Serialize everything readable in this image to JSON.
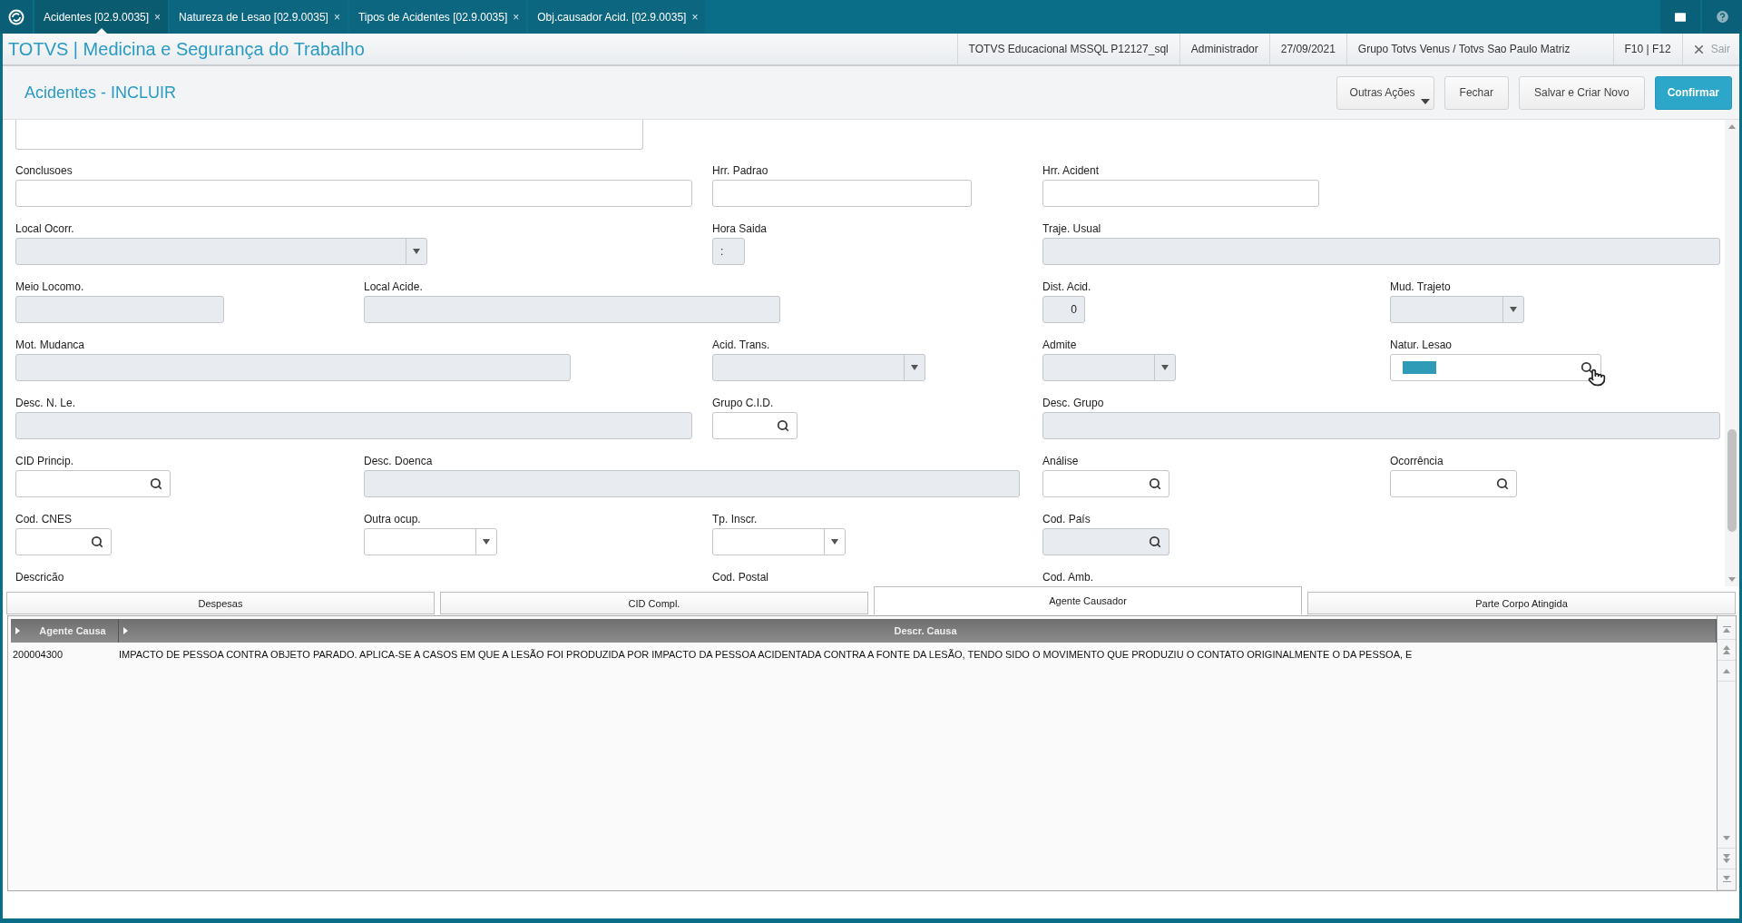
{
  "top_tabs": [
    {
      "label": "Acidentes [02.9.0035]",
      "close": "×",
      "selected": true
    },
    {
      "label": "Natureza de Lesao [02.9.0035]",
      "close": "×",
      "selected": false
    },
    {
      "label": "Tipos de Acidentes [02.9.0035]",
      "close": "×",
      "selected": false
    },
    {
      "label": "Obj.causador Acid. [02.9.0035]",
      "close": "×",
      "selected": false
    }
  ],
  "app_title": "TOTVS | Medicina e Segurança do Trabalho",
  "session_info": [
    "TOTVS Educacional MSSQL P12127_sql",
    "Administrador",
    "27/09/2021",
    "Grupo Totvs Venus / Totvs Sao Paulo Matriz"
  ],
  "hotkeys": "F10 | F12",
  "exit_label": "Sair",
  "page_title": "Acidentes - INCLUIR",
  "actions": [
    {
      "label": "Outras Ações",
      "kind": "menu"
    },
    {
      "label": "Fechar",
      "kind": "default"
    },
    {
      "label": "Salvar e Criar Novo",
      "kind": "default"
    },
    {
      "label": "Confirmar",
      "kind": "primary"
    }
  ],
  "form_rows": [
    {
      "fields": [
        {
          "label": "Conclusoes",
          "kind": "text",
          "disabled": false,
          "highlighted": false
        },
        {
          "label": "Hrr. Padrao",
          "kind": "text",
          "disabled": false,
          "highlighted": false
        },
        {
          "label": "Hrr. Acident",
          "kind": "text",
          "disabled": false,
          "highlighted": false
        }
      ]
    },
    {
      "fields": [
        {
          "label": "Local Ocorr.",
          "kind": "select",
          "disabled": true,
          "highlighted": false
        },
        {
          "label": "Hora Saida",
          "kind": "text",
          "disabled": true,
          "highlighted": false,
          "value": ":"
        },
        {
          "label": "Traje. Usual",
          "kind": "text",
          "disabled": true,
          "highlighted": false
        }
      ]
    },
    {
      "fields": [
        {
          "label": "Meio Locomo.",
          "kind": "text",
          "disabled": true,
          "highlighted": false
        },
        {
          "label": "Local Acide.",
          "kind": "text",
          "disabled": true,
          "highlighted": false
        },
        {
          "label": "Dist. Acid.",
          "kind": "number",
          "disabled": true,
          "highlighted": false,
          "value": "0"
        },
        {
          "label": "Mud. Trajeto",
          "kind": "select",
          "disabled": true,
          "highlighted": false
        }
      ]
    },
    {
      "fields": [
        {
          "label": "Mot. Mudanca",
          "kind": "text",
          "disabled": true,
          "highlighted": false
        },
        {
          "label": "Acid. Trans.",
          "kind": "select",
          "disabled": true,
          "highlighted": false
        },
        {
          "label": "Admite",
          "kind": "select",
          "disabled": true,
          "highlighted": false
        },
        {
          "label": "Natur. Lesao",
          "kind": "lookup",
          "disabled": false,
          "highlighted": true
        }
      ]
    },
    {
      "fields": [
        {
          "label": "Desc. N. Le.",
          "kind": "text",
          "disabled": true,
          "highlighted": false
        },
        {
          "label": "Grupo C.I.D.",
          "kind": "lookup",
          "disabled": false,
          "highlighted": false
        },
        {
          "label": "Desc. Grupo",
          "kind": "text",
          "disabled": true,
          "highlighted": false
        }
      ]
    },
    {
      "fields": [
        {
          "label": "CID Princip.",
          "kind": "lookup",
          "disabled": false,
          "highlighted": false
        },
        {
          "label": "Desc. Doenca",
          "kind": "text",
          "disabled": true,
          "highlighted": false
        },
        {
          "label": "Análise",
          "kind": "lookup",
          "disabled": false,
          "highlighted": false
        },
        {
          "label": "Ocorrência",
          "kind": "lookup",
          "disabled": false,
          "highlighted": false
        }
      ]
    },
    {
      "fields": [
        {
          "label": "Cod. CNES",
          "kind": "lookup",
          "disabled": false,
          "highlighted": false
        },
        {
          "label": "Outra ocup.",
          "kind": "select",
          "disabled": false,
          "highlighted": false
        },
        {
          "label": "Tp. Inscr.",
          "kind": "select",
          "disabled": false,
          "highlighted": false
        },
        {
          "label": "Cod. País",
          "kind": "lookup",
          "disabled": true,
          "highlighted": false
        }
      ]
    },
    {
      "fields": [
        {
          "label": "Descricão",
          "kind": "cut"
        },
        {
          "label": "Cod. Postal",
          "kind": "cut"
        },
        {
          "label": "Cod. Amb.",
          "kind": "cut"
        }
      ]
    }
  ],
  "detail_tabs": [
    {
      "label": "Despesas",
      "selected": false
    },
    {
      "label": "CID Compl.",
      "selected": false
    },
    {
      "label": "Agente Causador",
      "selected": true
    },
    {
      "label": "Parte Corpo Atingida",
      "selected": false
    }
  ],
  "grid": {
    "columns": [
      "Agente Causa",
      "Descr. Causa"
    ],
    "rows": [
      [
        "200004300",
        "IMPACTO DE PESSOA CONTRA OBJETO PARADO. APLICA-SE A CASOS EM QUE A LESÃO FOI PRODUZIDA POR IMPACTO DA PESSOA ACIDENTADA CONTRA A FONTE DA LESÃO, TENDO SIDO O MOVIMENTO QUE PRODUZIU O CONTATO ORIGINALMENTE O DA PESSOA, E"
      ]
    ]
  }
}
